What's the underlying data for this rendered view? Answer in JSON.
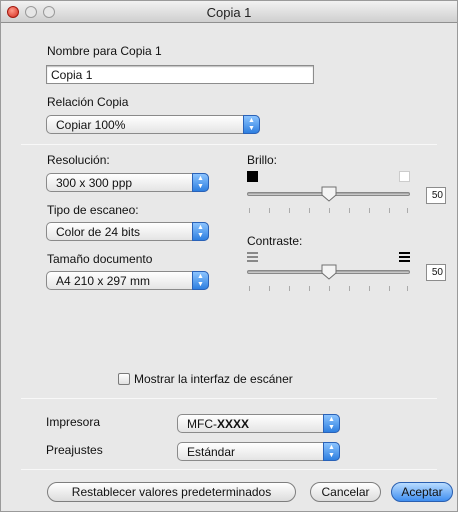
{
  "window": {
    "title": "Copia 1"
  },
  "name_section": {
    "label": "Nombre para Copia 1",
    "value": "Copia 1"
  },
  "relation": {
    "label": "Relación Copia",
    "value": "Copiar 100%"
  },
  "resolution": {
    "label": "Resolución:",
    "value": "300 x 300 ppp"
  },
  "scan_type": {
    "label": "Tipo de escaneo:",
    "value": "Color de 24 bits"
  },
  "doc_size": {
    "label": "Tamaño documento",
    "value": "A4  210 x 297 mm"
  },
  "brightness": {
    "label": "Brillo:",
    "value": "50",
    "level": 0.5
  },
  "contrast": {
    "label": "Contraste:",
    "value": "50",
    "level": 0.5
  },
  "show_interface": {
    "label": "Mostrar la interfaz de escáner",
    "checked": false
  },
  "printer": {
    "label": "Impresora",
    "value_prefix": "MFC-",
    "value_suffix": "XXXX"
  },
  "presets": {
    "label": "Preajustes",
    "value": "Estándar"
  },
  "buttons": {
    "reset": "Restablecer valores predeterminados",
    "cancel": "Cancelar",
    "accept": "Aceptar"
  },
  "icons": {
    "close": "close-traffic-light",
    "minimize": "minimize-traffic-light",
    "zoom": "zoom-traffic-light"
  },
  "colors": {
    "accent": "#3f8ef0",
    "close_button": "#d42a1c"
  }
}
